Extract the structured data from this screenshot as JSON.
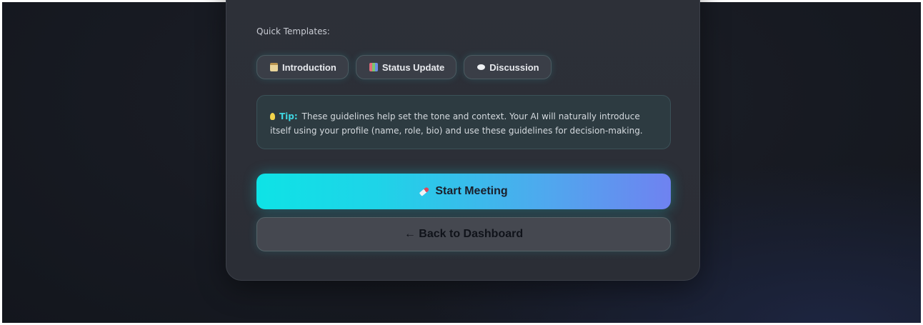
{
  "templates_section": {
    "label": "Quick Templates:",
    "buttons": [
      {
        "label": "Introduction",
        "icon": "clipboard-icon"
      },
      {
        "label": "Status Update",
        "icon": "bar-chart-icon"
      },
      {
        "label": "Discussion",
        "icon": "speech-bubble-icon"
      }
    ]
  },
  "tip": {
    "icon": "lightbulb-icon",
    "label": "Tip:",
    "text": "These guidelines help set the tone and context. Your AI will naturally introduce itself using your profile (name, role, bio) and use these guidelines for decision-making."
  },
  "actions": {
    "start_label": "Start Meeting",
    "start_icon": "rocket-icon",
    "back_label": "← Back to Dashboard"
  },
  "colors": {
    "accent_cyan": "#0ee3e6",
    "accent_violet": "#6f82f0",
    "tip_label": "#3fd4e0"
  }
}
